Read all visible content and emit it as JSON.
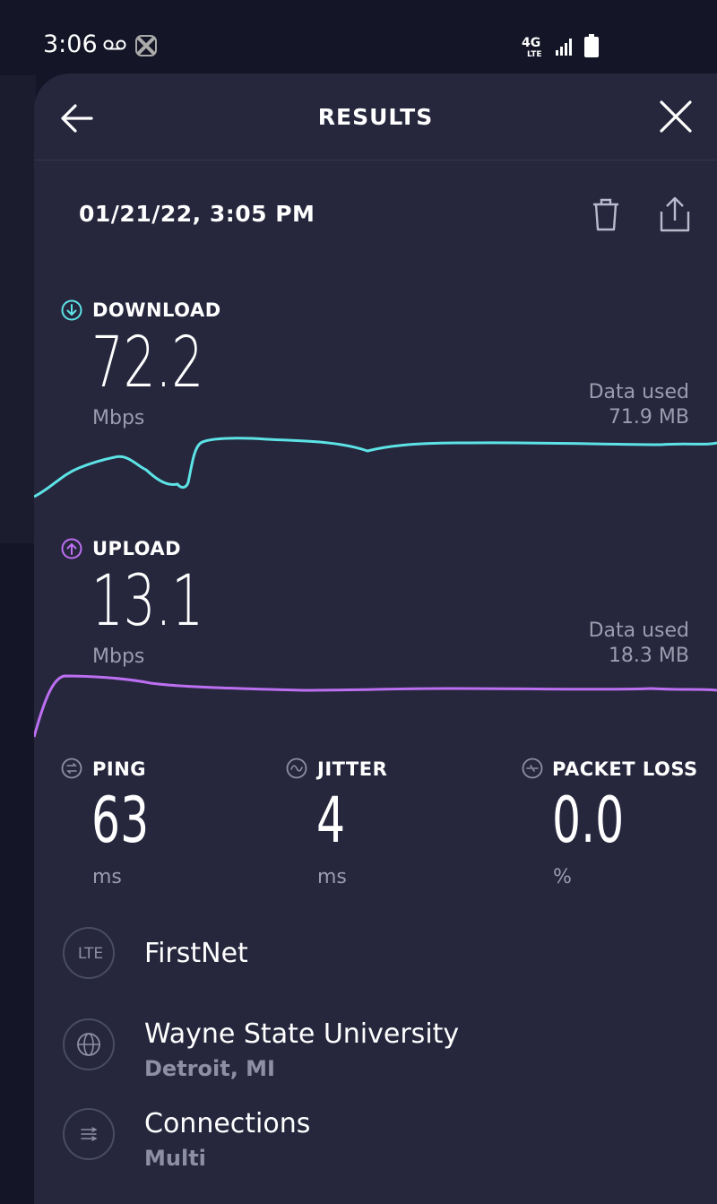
{
  "status_bar": {
    "time": "3:06",
    "network": "4G",
    "network_sub": "LTE"
  },
  "header": {
    "title": "RESULTS"
  },
  "result": {
    "date": "01/21/22, 3:05 PM"
  },
  "download": {
    "label": "DOWNLOAD",
    "value": "72.2",
    "unit": "Mbps",
    "data_used_label": "Data used",
    "data_used_value": "71.9 MB"
  },
  "upload": {
    "label": "UPLOAD",
    "value": "13.1",
    "unit": "Mbps",
    "data_used_label": "Data used",
    "data_used_value": "18.3 MB"
  },
  "ping": {
    "label": "PING",
    "value": "63",
    "unit": "ms"
  },
  "jitter": {
    "label": "JITTER",
    "value": "4",
    "unit": "ms"
  },
  "packet_loss": {
    "label": "PACKET LOSS",
    "value": "0.0",
    "unit": "%"
  },
  "provider": {
    "badge": "LTE",
    "name": "FirstNet"
  },
  "server": {
    "name": "Wayne State University",
    "location": "Detroit, MI"
  },
  "connections": {
    "label": "Connections",
    "value": "Multi"
  },
  "colors": {
    "download": "#5de3e6",
    "upload": "#bd6ff2",
    "background": "#26273d"
  },
  "icons": {
    "back": "arrow-left-icon",
    "close": "close-icon",
    "delete": "trash-icon",
    "share": "share-icon",
    "download": "download-arrow-icon",
    "upload": "upload-arrow-icon",
    "ping": "ping-icon",
    "jitter": "jitter-icon",
    "packet_loss": "packet-loss-icon",
    "provider": "lte-icon",
    "server": "globe-icon",
    "connections": "connections-icon"
  }
}
